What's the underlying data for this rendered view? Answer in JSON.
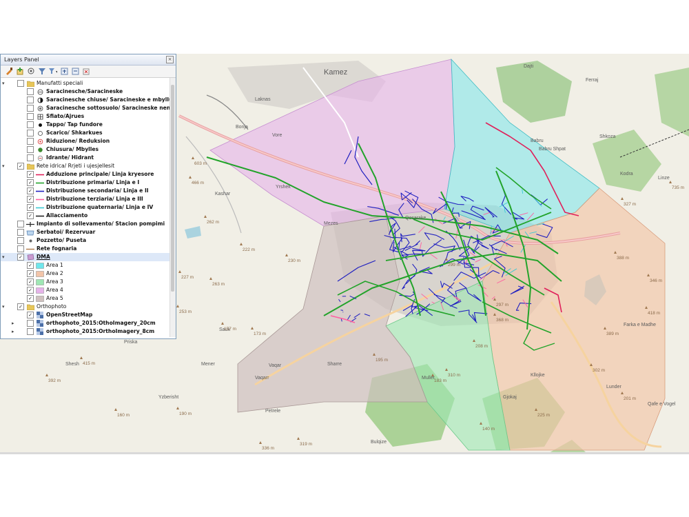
{
  "panel": {
    "title": "Layers Panel",
    "close_glyph": "×",
    "toolbar_icons": [
      "paint-icon",
      "add-group-icon",
      "manage-icon",
      "filter-icon",
      "filter-legend-icon",
      "expand-all-icon",
      "collapse-all-icon",
      "remove-icon"
    ]
  },
  "tree": [
    {
      "indent": 0,
      "expand": "▾",
      "checked": false,
      "symbol": "group-icon",
      "label": "Manufatti speciali",
      "bold": false
    },
    {
      "indent": 1,
      "checked": false,
      "symbol": "valve-icon",
      "label": "Saracinesche/Saracineske",
      "bold": true
    },
    {
      "indent": 1,
      "checked": false,
      "symbol": "valve-closed-icon",
      "label": "Saracinesche chiuse/ Saracineske e mbyllur",
      "bold": true
    },
    {
      "indent": 1,
      "checked": false,
      "symbol": "valve-underground-icon",
      "label": "Saracinesche sottosuolo/ Saracineske nent...",
      "bold": true
    },
    {
      "indent": 1,
      "checked": false,
      "symbol": "air-valve-icon",
      "label": "Sfiato/Ajrues",
      "bold": true
    },
    {
      "indent": 1,
      "checked": false,
      "symbol": "dot-icon",
      "label": "Tappo/ Tap fundore",
      "bold": true
    },
    {
      "indent": 1,
      "checked": false,
      "symbol": "circle-icon",
      "label": "Scarico/ Shkarkues",
      "bold": true
    },
    {
      "indent": 1,
      "checked": false,
      "symbol": "reducer-icon",
      "label": "Riduzione/ Reduksion",
      "bold": true
    },
    {
      "indent": 1,
      "checked": false,
      "symbol": "green-dot-icon",
      "label": "Chiusura/ Mbylles",
      "bold": true
    },
    {
      "indent": 1,
      "checked": false,
      "symbol": "hydrant-icon",
      "label": "Idrante/ Hidrant",
      "bold": true
    },
    {
      "indent": 0,
      "expand": "▾",
      "checked": true,
      "symbol": "group-icon",
      "label": "Rete idrica/ Rrjeti i ujesjellesit",
      "bold": false
    },
    {
      "indent": 1,
      "checked": true,
      "symbol": "line-red-icon",
      "label": "Adduzione principale/ Linja kryesore",
      "bold": true
    },
    {
      "indent": 1,
      "checked": true,
      "symbol": "line-green-icon",
      "label": "Distribuzione primaria/ Linja e I",
      "bold": true
    },
    {
      "indent": 1,
      "checked": true,
      "symbol": "line-blue-icon",
      "label": "Distribuzione secondaria/ Linja e II",
      "bold": true
    },
    {
      "indent": 1,
      "checked": true,
      "symbol": "line-pink-icon",
      "label": "Distribuzione terziaria/ Linja e III",
      "bold": true
    },
    {
      "indent": 1,
      "checked": true,
      "symbol": "line-cyan-icon",
      "label": "Distribuzione quaternaria/ Linja e IV",
      "bold": true
    },
    {
      "indent": 1,
      "checked": true,
      "symbol": "line-black-icon",
      "label": "Allacciamento",
      "bold": true
    },
    {
      "indent": 0,
      "checked": false,
      "symbol": "pump-icon",
      "label": "Impianto di sollevamento/ Stacion pompimi",
      "bold": true
    },
    {
      "indent": 0,
      "checked": false,
      "symbol": "reservoir-icon",
      "label": "Serbatoi/ Rezervuar",
      "bold": true
    },
    {
      "indent": 0,
      "checked": false,
      "symbol": "manhole-icon",
      "label": "Pozzetto/ Puseta",
      "bold": true
    },
    {
      "indent": 0,
      "checked": false,
      "symbol": "sewer-line-icon",
      "label": "Rete fognaria",
      "bold": true
    },
    {
      "indent": 0,
      "expand": "▾",
      "checked": true,
      "symbol": "dma-layer-icon",
      "label": "DMA",
      "bold": true,
      "underline": true,
      "selected": true
    },
    {
      "indent": 1,
      "checked": true,
      "symbol": "swatch-area1-icon",
      "label": "Area 1",
      "bold": false
    },
    {
      "indent": 1,
      "checked": true,
      "symbol": "swatch-area2-icon",
      "label": "Area 2",
      "bold": false
    },
    {
      "indent": 1,
      "checked": true,
      "symbol": "swatch-area3-icon",
      "label": "Area 3",
      "bold": false
    },
    {
      "indent": 1,
      "checked": true,
      "symbol": "swatch-area4-icon",
      "label": "Area 4",
      "bold": false
    },
    {
      "indent": 1,
      "checked": true,
      "symbol": "swatch-area5-icon",
      "label": "Area 5",
      "bold": false
    },
    {
      "indent": 0,
      "expand": "▾",
      "checked": true,
      "symbol": "group-icon",
      "label": "Orthophoto",
      "bold": false
    },
    {
      "indent": 1,
      "checked": true,
      "symbol": "raster-icon",
      "label": "OpenStreetMap",
      "bold": true
    },
    {
      "indent": 1,
      "expand": "▸",
      "checked": false,
      "symbol": "raster-icon",
      "label": "orthophoto_2015:OthoImagery_20cm",
      "bold": true
    },
    {
      "indent": 1,
      "expand": "▸",
      "checked": false,
      "symbol": "raster-icon",
      "label": "orthophoto_2015:OrthoImagery_8cm",
      "bold": true
    }
  ],
  "colors": {
    "area1": "#6fe6ec",
    "area2": "#f2c4a8",
    "area3": "#9fe7b4",
    "area4": "#e6b3ea",
    "area5": "#cfc1bf",
    "adduzione": "#e0205a",
    "primaria": "#22a32a",
    "secondaria": "#2020c0",
    "terziaria": "#ff5fa0",
    "quaternaria": "#39c9d3",
    "allacciamento": "#222222"
  },
  "map": {
    "places": [
      {
        "name": "Kamez",
        "size": "large"
      },
      {
        "name": "Laknas",
        "size": "small"
      },
      {
        "name": "Bonja",
        "size": "small"
      },
      {
        "name": "Vore",
        "size": "small"
      },
      {
        "name": "Yrshek",
        "size": "small"
      },
      {
        "name": "Kashar",
        "size": "small"
      },
      {
        "name": "Mezes",
        "size": "small"
      },
      {
        "name": "Ferraj",
        "size": "small"
      },
      {
        "name": "Dajti",
        "size": "small"
      },
      {
        "name": "Babru",
        "size": "small"
      },
      {
        "name": "Babru Shpat",
        "size": "small"
      },
      {
        "name": "Shkoza",
        "size": "small"
      },
      {
        "name": "Qesarake",
        "size": "small"
      },
      {
        "name": "Linze",
        "size": "small"
      },
      {
        "name": "Kodra",
        "size": "small"
      },
      {
        "name": "Lunder",
        "size": "small"
      },
      {
        "name": "Farka e Madhe",
        "size": "small"
      },
      {
        "name": "Sauk",
        "size": "small"
      },
      {
        "name": "Shesh",
        "size": "small"
      },
      {
        "name": "Mener",
        "size": "small"
      },
      {
        "name": "Vaqar",
        "size": "small"
      },
      {
        "name": "Sharre",
        "size": "small"
      },
      {
        "name": "Yzberisht",
        "size": "small"
      },
      {
        "name": "Vaqarr",
        "size": "small"
      },
      {
        "name": "Mullet",
        "size": "small"
      },
      {
        "name": "Petrele",
        "size": "small"
      },
      {
        "name": "Qafe e Vogel",
        "size": "small"
      },
      {
        "name": "Bulqize",
        "size": "small"
      },
      {
        "name": "Gjokaj",
        "size": "small"
      },
      {
        "name": "Lalm",
        "size": "small"
      },
      {
        "name": "Priska",
        "size": "small"
      },
      {
        "name": "Kllojke",
        "size": "small"
      }
    ],
    "elevations": [
      "603 m",
      "466 m",
      "262 m",
      "222 m",
      "227 m",
      "157 m",
      "230 m",
      "253 m",
      "173 m",
      "263 m",
      "415 m",
      "392 m",
      "336 m",
      "319 m",
      "327 m",
      "735 m",
      "388 m",
      "346 m",
      "418 m",
      "389 m",
      "297 m",
      "299 m",
      "368 m",
      "195 m",
      "183 m",
      "208 m",
      "310 m",
      "302 m",
      "201 m",
      "225 m",
      "140 m",
      "190 m",
      "160 m"
    ]
  }
}
